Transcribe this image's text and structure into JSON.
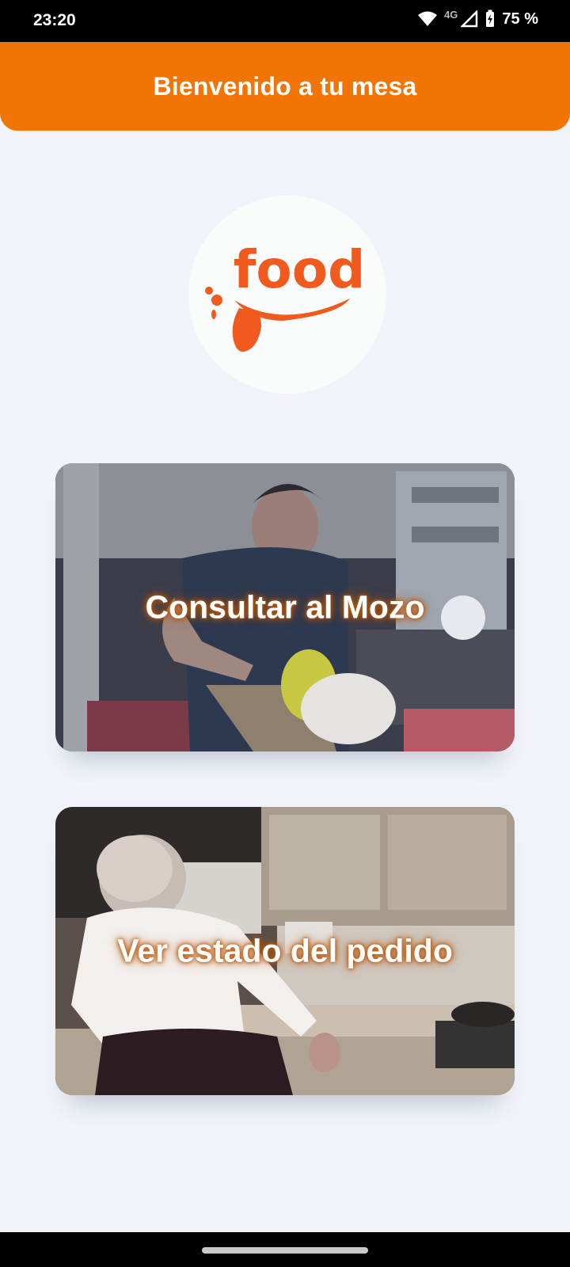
{
  "status_bar": {
    "time": "23:20",
    "network": "4G",
    "battery": "75 %",
    "icons": [
      "wifi-icon",
      "signal-icon",
      "battery-charging-icon"
    ]
  },
  "header": {
    "title": "Bienvenido a tu mesa",
    "color": "#f27405"
  },
  "logo": {
    "text": "food",
    "color": "#f05a1f"
  },
  "actions": [
    {
      "label": "Consultar al Mozo"
    },
    {
      "label": "Ver estado del pedido"
    }
  ],
  "colors": {
    "background": "#f0f3f9",
    "accent": "#f27405",
    "label_glow": "#b8560a"
  }
}
